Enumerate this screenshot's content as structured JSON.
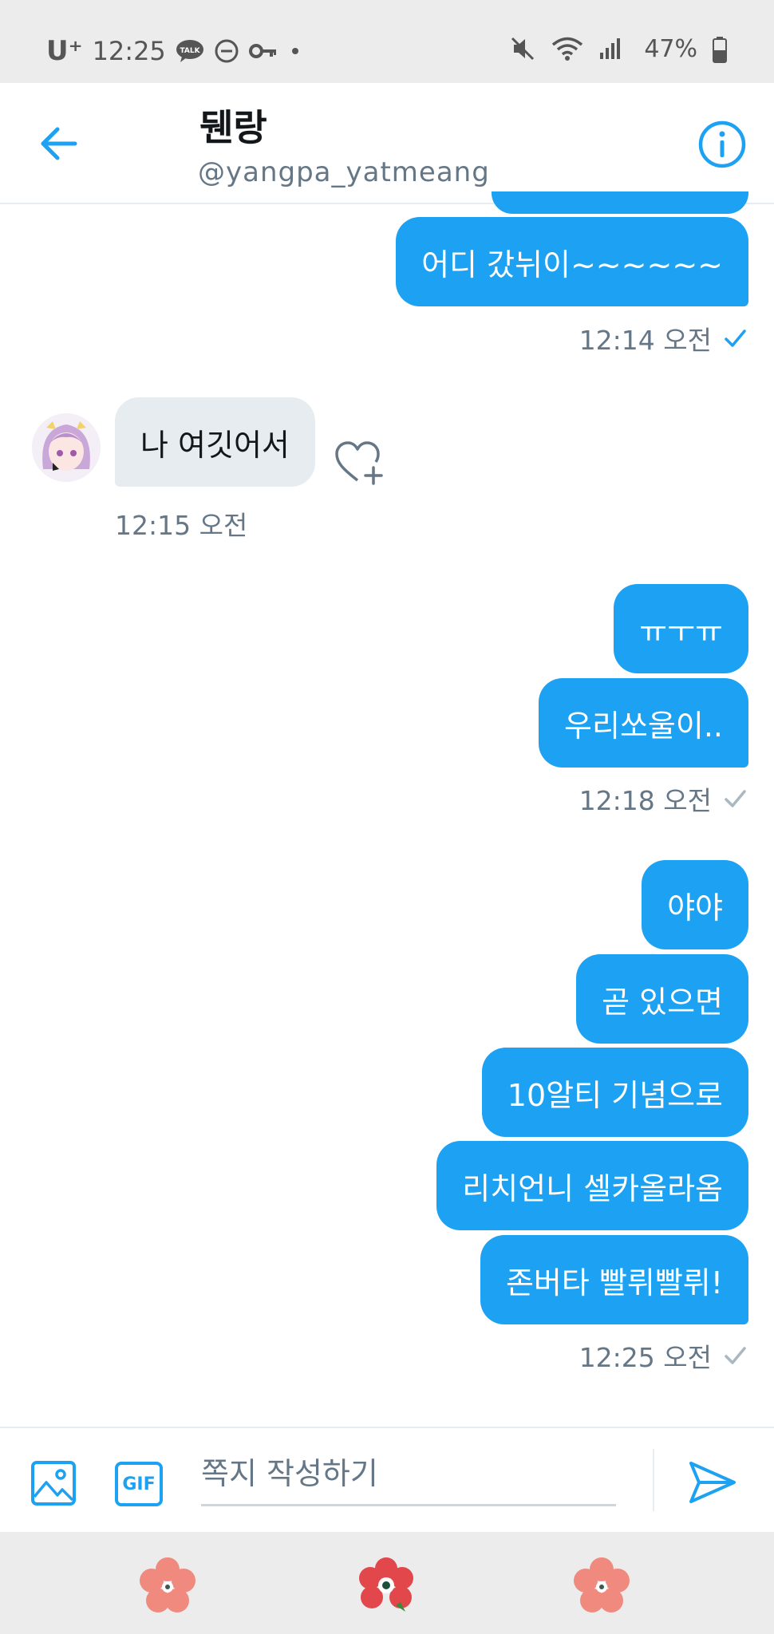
{
  "status_bar": {
    "carrier": "U⁺",
    "time": "12:25",
    "battery": "47%",
    "icons": [
      "talk-icon",
      "do-not-disturb-icon",
      "vpn-key-icon",
      "dot-icon",
      "mute-icon",
      "wifi-icon",
      "signal-icon",
      "battery-icon"
    ]
  },
  "header": {
    "title": "뒌랑",
    "handle": "@yangpa_yatmeang",
    "accent": "#1da1f2"
  },
  "messages": [
    {
      "dir": "out",
      "text": "어디 갔뉘이~~~~~~"
    },
    {
      "dir": "in",
      "text": "나 여깃어서"
    },
    {
      "dir": "out",
      "text": "ㅠㅜㅠ"
    },
    {
      "dir": "out",
      "text": "우리쏘울이.."
    },
    {
      "dir": "out",
      "text": "야야"
    },
    {
      "dir": "out",
      "text": "곧 있으면"
    },
    {
      "dir": "out",
      "text": "10알티 기념으로"
    },
    {
      "dir": "out",
      "text": "리치언니 셀카올라옴"
    },
    {
      "dir": "out",
      "text": "존버타 빨뤼빨뤼!"
    }
  ],
  "timestamps": {
    "t1": "12:14 오전",
    "t2": "12:15 오전",
    "t3": "12:18 오전",
    "t4": "12:25 오전"
  },
  "composer": {
    "placeholder": "쪽지 작성하기",
    "gif_label": "GIF"
  }
}
